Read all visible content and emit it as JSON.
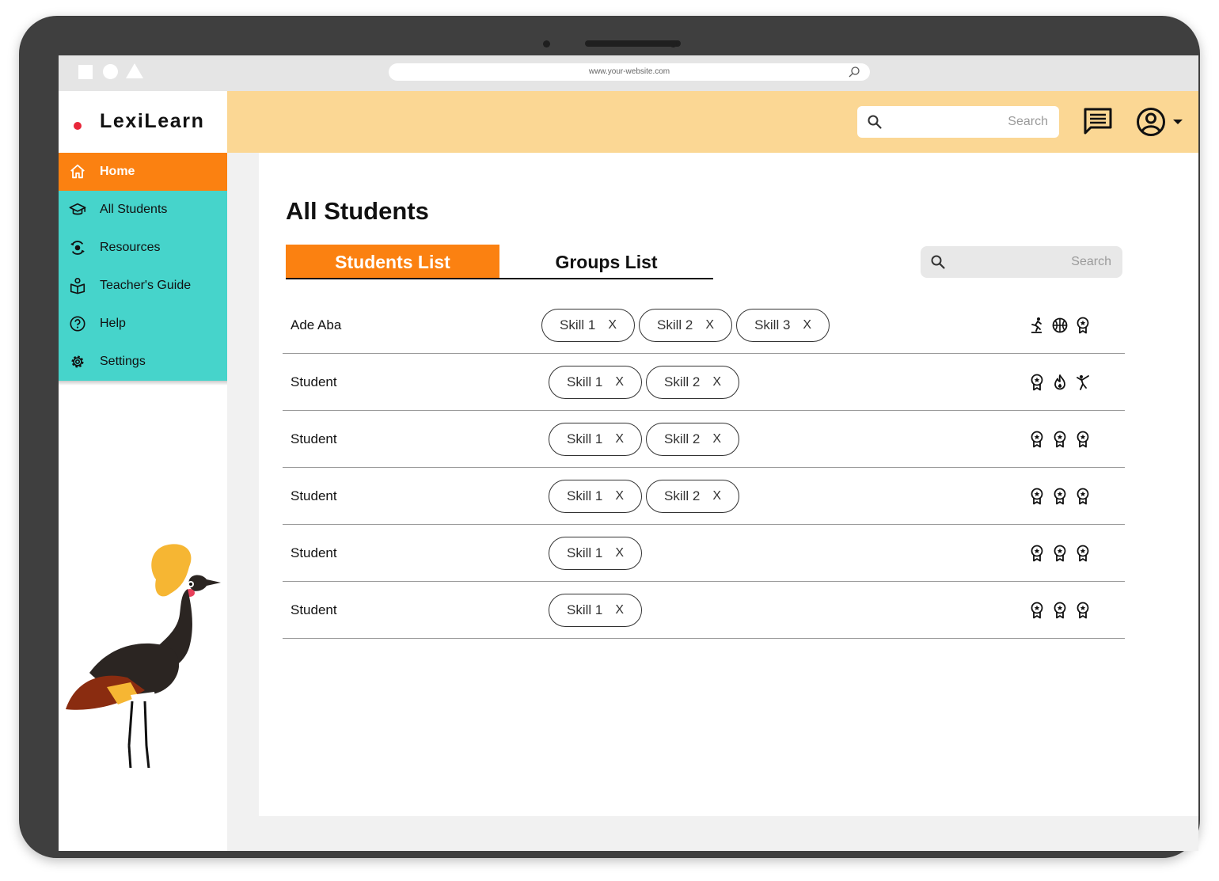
{
  "browser": {
    "url": "www.your-website.com"
  },
  "app": {
    "name": "LexiLearn"
  },
  "sidebar": {
    "items": [
      {
        "label": "Home",
        "icon": "home-icon",
        "active": true
      },
      {
        "label": "All Students",
        "icon": "graduation-cap-icon",
        "active": false
      },
      {
        "label": "Resources",
        "icon": "resources-icon",
        "active": false
      },
      {
        "label": "Teacher's Guide",
        "icon": "book-reader-icon",
        "active": false
      },
      {
        "label": "Help",
        "icon": "help-circle-icon",
        "active": false
      },
      {
        "label": "Settings",
        "icon": "gear-icon",
        "active": false
      }
    ]
  },
  "header": {
    "search_placeholder": "Search"
  },
  "main": {
    "title": "All Students",
    "tabs": [
      {
        "label": "Students List",
        "active": true
      },
      {
        "label": "Groups List",
        "active": false
      }
    ],
    "search_placeholder": "Search",
    "students": [
      {
        "name": "Ade Aba",
        "skills": [
          "Skill 1",
          "Skill 2",
          "Skill 3"
        ],
        "badges": [
          "skater-icon",
          "basketball-icon",
          "award-icon"
        ]
      },
      {
        "name": "Student",
        "skills": [
          "Skill 1",
          "Skill 2"
        ],
        "badges": [
          "award-icon",
          "flame-icon",
          "martial-arts-icon"
        ]
      },
      {
        "name": "Student",
        "skills": [
          "Skill 1",
          "Skill 2"
        ],
        "badges": [
          "award-icon",
          "award-icon",
          "award-icon"
        ]
      },
      {
        "name": "Student",
        "skills": [
          "Skill 1",
          "Skill 2"
        ],
        "badges": [
          "award-icon",
          "award-icon",
          "award-icon"
        ]
      },
      {
        "name": "Student",
        "skills": [
          "Skill 1"
        ],
        "badges": [
          "award-icon",
          "award-icon",
          "award-icon"
        ]
      },
      {
        "name": "Student",
        "skills": [
          "Skill 1"
        ],
        "badges": [
          "award-icon",
          "award-icon",
          "award-icon"
        ]
      }
    ],
    "chip_remove_label": "X"
  },
  "colors": {
    "accent_orange": "#fb8111",
    "nav_teal": "#46d4cb",
    "header_yellow": "#fbd794",
    "logo_dot_red": "#e8273a"
  }
}
